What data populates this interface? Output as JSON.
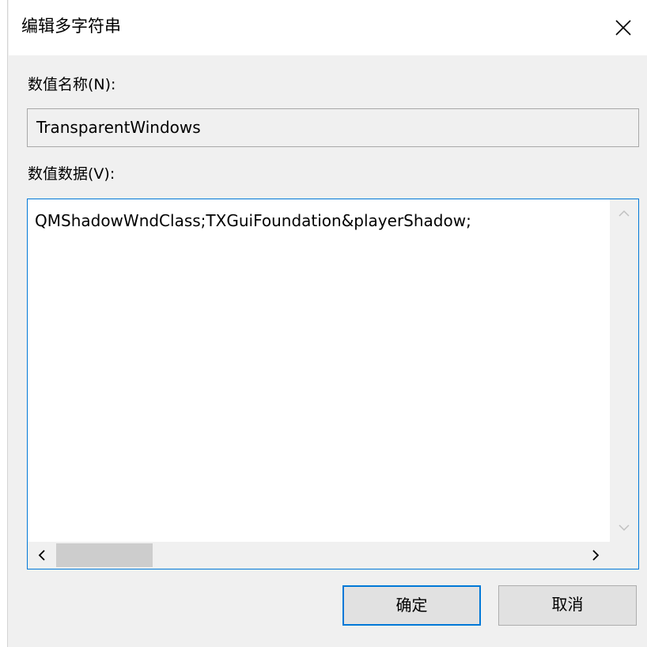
{
  "dialog": {
    "title": "编辑多字符串",
    "close_icon": "close-icon"
  },
  "value_name": {
    "label": "数值名称(N):",
    "value": "TransparentWindows"
  },
  "value_data": {
    "label": "数值数据(V):",
    "value": "QMShadowWndClass;TXGuiFoundation&playerShadow;"
  },
  "buttons": {
    "ok": "确定",
    "cancel": "取消"
  },
  "colors": {
    "accent": "#0078d7",
    "dialog_bg": "#f0f0f0",
    "scroll_thumb": "#cdcdcd"
  }
}
